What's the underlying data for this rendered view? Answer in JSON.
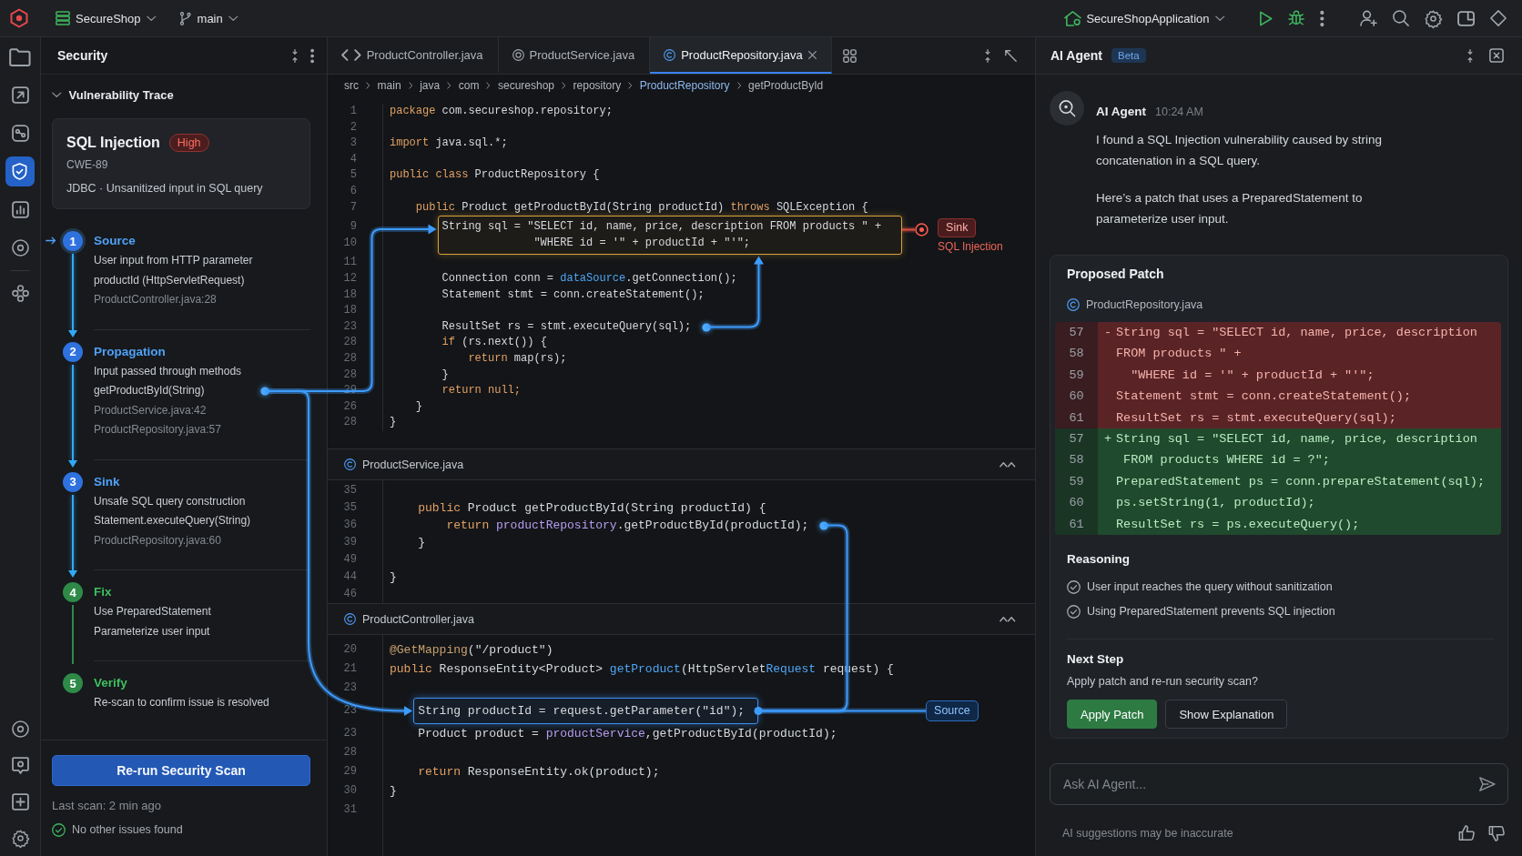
{
  "top_bar": {
    "project": "SecureShop",
    "branch": "main",
    "run_configuration": "SecureShopApplication"
  },
  "activity_bar": {
    "top": [
      {
        "selected": false
      },
      {
        "selected": false
      },
      {
        "selected": false
      },
      {
        "selected": true
      },
      {
        "selected": false
      },
      {
        "selected": false
      },
      {
        "selected": false
      }
    ],
    "bottom": [
      {
        "selected": false
      },
      {
        "selected": false
      },
      {
        "selected": false
      },
      {
        "selected": false
      }
    ]
  },
  "security_panel": {
    "title": "Security",
    "trace": {
      "title": "Vulnerability Trace",
      "expanded": true
    },
    "issue": {
      "title": "SQL Injection",
      "severity": "High",
      "cwe": "CWE-89",
      "summary": "JDBC · Unsanitized input in SQL query"
    },
    "steps": [
      {
        "number": "1",
        "title": "Source",
        "kind": "trace",
        "selected": true,
        "trace_point": false,
        "details": [
          "User input from HTTP parameter",
          "productId (HttpServletRequest)"
        ],
        "locations": [
          "ProductController.java:28"
        ]
      },
      {
        "number": "2",
        "title": "Propagation",
        "kind": "trace",
        "selected": false,
        "trace_point": true,
        "details": [
          "Input passed through methods",
          "getProductById(String)"
        ],
        "locations": [
          "ProductService.java:42",
          "ProductRepository.java:57"
        ]
      },
      {
        "number": "3",
        "title": "Sink",
        "kind": "trace",
        "selected": false,
        "trace_point": false,
        "details": [
          "Unsafe SQL query construction",
          "Statement.executeQuery(String)"
        ],
        "locations": [
          "ProductRepository.java:60"
        ]
      },
      {
        "number": "4",
        "title": "Fix",
        "kind": "fix",
        "selected": false,
        "trace_point": false,
        "details": [
          "Use PreparedStatement",
          "Parameterize user input"
        ]
      },
      {
        "number": "5",
        "title": "Verify",
        "kind": "fix",
        "selected": false,
        "trace_point": false,
        "details": [
          "Re-scan to confirm issue is resolved"
        ]
      }
    ],
    "scan_button": "Re-run Security Scan",
    "last_scan": "Last scan: 2 min ago",
    "status": "No other issues found"
  },
  "editor": {
    "tabs": [
      {
        "label": "ProductController.java",
        "selected": false
      },
      {
        "label": "ProductService.java",
        "selected": false
      },
      {
        "label": "ProductRepository.java",
        "selected": true
      }
    ],
    "breadcrumb": [
      {
        "label": "src",
        "selected": false
      },
      {
        "label": "main",
        "selected": false
      },
      {
        "label": "java",
        "selected": false
      },
      {
        "label": "com",
        "selected": false
      },
      {
        "label": "secureshop",
        "selected": false
      },
      {
        "label": "repository",
        "selected": false
      },
      {
        "label": "ProductRepository",
        "selected": true
      },
      {
        "label": "getProductById",
        "selected": false
      }
    ],
    "main_code": {
      "lines": [
        {
          "number": "1",
          "kind": "plain",
          "trace_point": false,
          "tokens": [
            {
              "text": "package",
              "kind": "keyword"
            },
            {
              "text": " com.secureshop.repository;",
              "kind": "plain"
            }
          ]
        },
        {
          "number": "2",
          "kind": "plain",
          "trace_point": false
        },
        {
          "number": "3",
          "kind": "plain",
          "trace_point": false,
          "tokens": [
            {
              "text": "import",
              "kind": "keyword"
            },
            {
              "text": " java.sql.*;",
              "kind": "plain"
            }
          ]
        },
        {
          "number": "4",
          "kind": "plain",
          "trace_point": false
        },
        {
          "number": "5",
          "kind": "plain",
          "trace_point": false,
          "tokens": [
            {
              "text": "public class",
              "kind": "keyword"
            },
            {
              "text": " ProductRepository {",
              "kind": "plain"
            }
          ]
        },
        {
          "number": "6",
          "kind": "plain",
          "trace_point": false
        },
        {
          "number": "7",
          "kind": "plain",
          "trace_point": false,
          "tokens": [
            {
              "text": "    public",
              "kind": "keyword"
            },
            {
              "text": " Product getProductById(String productId) ",
              "kind": "plain"
            },
            {
              "text": "throws",
              "kind": "keyword"
            },
            {
              "text": " SQLException {",
              "kind": "plain"
            }
          ]
        },
        {
          "number": "9",
          "kind": "sink",
          "trace_point": false,
          "badge": "Sink",
          "badge_note": "SQL Injection",
          "tokens": [
            {
              "text": "        String sql = \"SELECT id, name, price, description FROM products \" +",
              "kind": "plain"
            }
          ]
        },
        {
          "number": "10",
          "kind": "sink",
          "trace_point": false,
          "tokens": [
            {
              "text": "                      \"WHERE id = '\" + productId + \"'\";",
              "kind": "plain"
            }
          ]
        },
        {
          "number": "11",
          "kind": "plain",
          "trace_point": false
        },
        {
          "number": "12",
          "kind": "plain",
          "trace_point": false,
          "tokens": [
            {
              "text": "        Connection conn = ",
              "kind": "plain"
            },
            {
              "text": "dataSource",
              "kind": "member"
            },
            {
              "text": ".getConnection();",
              "kind": "plain"
            }
          ]
        },
        {
          "number": "18",
          "kind": "plain",
          "trace_point": false,
          "tokens": [
            {
              "text": "        Statement stmt = conn.createStatement();",
              "kind": "plain"
            }
          ]
        },
        {
          "number": "18",
          "kind": "plain",
          "trace_point": false
        },
        {
          "number": "23",
          "kind": "plain",
          "trace_point": true,
          "tokens": [
            {
              "text": "        ResultSet rs = stmt.executeQuery(sql);",
              "kind": "plain"
            }
          ]
        },
        {
          "number": "28",
          "kind": "plain",
          "trace_point": false,
          "tokens": [
            {
              "text": "        if",
              "kind": "keyword"
            },
            {
              "text": " (rs.next()) {",
              "kind": "plain"
            }
          ]
        },
        {
          "number": "28",
          "kind": "plain",
          "trace_point": false,
          "tokens": [
            {
              "text": "            return",
              "kind": "keyword"
            },
            {
              "text": " map(rs);",
              "kind": "plain"
            }
          ]
        },
        {
          "number": "28",
          "kind": "plain",
          "trace_point": false,
          "tokens": [
            {
              "text": "        }",
              "kind": "plain"
            }
          ]
        },
        {
          "number": "29",
          "kind": "plain",
          "trace_point": false,
          "tokens": [
            {
              "text": "        return null;",
              "kind": "keyword"
            }
          ]
        },
        {
          "number": "26",
          "kind": "plain",
          "trace_point": false,
          "tokens": [
            {
              "text": "    }",
              "kind": "plain"
            }
          ]
        },
        {
          "number": "28",
          "kind": "plain",
          "trace_point": false,
          "tokens": [
            {
              "text": "}",
              "kind": "plain"
            }
          ]
        }
      ]
    },
    "sections": [
      {
        "file": "ProductService.java",
        "expanded": true,
        "lines": [
          {
            "number": "35",
            "kind": "plain",
            "trace_point": false
          },
          {
            "number": "35",
            "kind": "plain",
            "trace_point": false,
            "tokens": [
              {
                "text": "    public",
                "kind": "keyword"
              },
              {
                "text": " Product getProductById(String productId) {",
                "kind": "plain"
              }
            ]
          },
          {
            "number": "36",
            "kind": "plain",
            "trace_point": true,
            "tokens": [
              {
                "text": "        return",
                "kind": "keyword"
              },
              {
                "text": " productRepository",
                "kind": "field"
              },
              {
                "text": ".getProductById(productId);",
                "kind": "plain"
              }
            ]
          },
          {
            "number": "39",
            "kind": "plain",
            "trace_point": false,
            "tokens": [
              {
                "text": "    }",
                "kind": "plain"
              }
            ]
          },
          {
            "number": "49",
            "kind": "plain",
            "trace_point": false
          },
          {
            "number": "44",
            "kind": "plain",
            "trace_point": false,
            "tokens": [
              {
                "text": "}",
                "kind": "plain"
              }
            ]
          },
          {
            "number": "46",
            "kind": "plain",
            "trace_point": false
          }
        ]
      },
      {
        "file": "ProductController.java",
        "expanded": true,
        "lines": [
          {
            "number": "20",
            "kind": "plain",
            "trace_point": false,
            "tokens": [
              {
                "text": "@GetMapping",
                "kind": "annotation"
              },
              {
                "text": "(\"/product\")",
                "kind": "plain"
              }
            ]
          },
          {
            "number": "21",
            "kind": "plain",
            "trace_point": false,
            "tokens": [
              {
                "text": "public",
                "kind": "keyword"
              },
              {
                "text": " ResponseEntity<Product> ",
                "kind": "plain"
              },
              {
                "text": "getProduct",
                "kind": "member"
              },
              {
                "text": "(HttpServlet",
                "kind": "plain"
              },
              {
                "text": "Request",
                "kind": "member"
              },
              {
                "text": " request) {",
                "kind": "plain"
              }
            ]
          },
          {
            "number": "23",
            "kind": "plain",
            "trace_point": false
          },
          {
            "number": "23",
            "kind": "source",
            "trace_point": false,
            "badge": "Source",
            "tokens": [
              {
                "text": "    String productId = request.getParameter(\"id\");",
                "kind": "plain"
              }
            ]
          },
          {
            "number": "23",
            "kind": "plain",
            "trace_point": false,
            "tokens": [
              {
                "text": "    Product product = ",
                "kind": "plain"
              },
              {
                "text": "productService",
                "kind": "field"
              },
              {
                "text": ",getProductById(productId);",
                "kind": "plain"
              }
            ]
          },
          {
            "number": "28",
            "kind": "plain",
            "trace_point": false
          },
          {
            "number": "29",
            "kind": "plain",
            "trace_point": false,
            "tokens": [
              {
                "text": "    return",
                "kind": "keyword"
              },
              {
                "text": " ResponseEntity.ok(product);",
                "kind": "plain"
              }
            ]
          },
          {
            "number": "30",
            "kind": "plain",
            "trace_point": false,
            "tokens": [
              {
                "text": "}",
                "kind": "plain"
              }
            ]
          },
          {
            "number": "31",
            "kind": "plain",
            "trace_point": false
          }
        ]
      }
    ]
  },
  "ai_agent": {
    "title": "AI Agent",
    "badge": "Beta",
    "message": {
      "author": "AI Agent",
      "time": "10:24 AM",
      "paragraphs": [
        "I found a SQL Injection vulnerability caused by string concatenation in a SQL query.",
        "Here’s a patch that uses a PreparedStatement to parameterize user input."
      ]
    },
    "patch": {
      "title": "Proposed Patch",
      "file": "ProductRepository.java",
      "lines": [
        {
          "kind": "removed",
          "number": "57",
          "sign": "-",
          "code": "String sql = \"SELECT id, name, price, description"
        },
        {
          "kind": "removed",
          "number": "58",
          "code": "FROM products \" +"
        },
        {
          "kind": "removed",
          "number": "59",
          "code": "  \"WHERE id = '\" + productId + \"'\";"
        },
        {
          "kind": "removed",
          "number": "60",
          "code": "Statement stmt = conn.createStatement();"
        },
        {
          "kind": "removed",
          "number": "61",
          "code": "ResultSet rs = stmt.executeQuery(sql);"
        },
        {
          "kind": "added",
          "number": "57",
          "sign": "+",
          "code": "String sql = \"SELECT id, name, price, description"
        },
        {
          "kind": "added",
          "number": "58",
          "code": " FROM products WHERE id = ?\";"
        },
        {
          "kind": "added",
          "number": "59",
          "code": "PreparedStatement ps = conn.prepareStatement(sql);"
        },
        {
          "kind": "added",
          "number": "60",
          "code": "ps.setString(1, productId);"
        },
        {
          "kind": "added",
          "number": "61",
          "code": "ResultSet rs = ps.executeQuery();"
        }
      ]
    },
    "reasoning": {
      "title": "Reasoning",
      "items": [
        {
          "text": "User input reaches the query without sanitization",
          "checked": true
        },
        {
          "text": "Using PreparedStatement prevents SQL injection",
          "checked": true
        }
      ]
    },
    "next_step": {
      "title": "Next Step",
      "question": "Apply patch and re-run security scan?",
      "buttons": [
        {
          "label": "Apply Patch",
          "kind": "primary"
        },
        {
          "label": "Show Explanation",
          "kind": "secondary"
        }
      ]
    },
    "input": {
      "placeholder": "Ask AI Agent..."
    },
    "disclaimer": "AI suggestions may be inaccurate"
  }
}
